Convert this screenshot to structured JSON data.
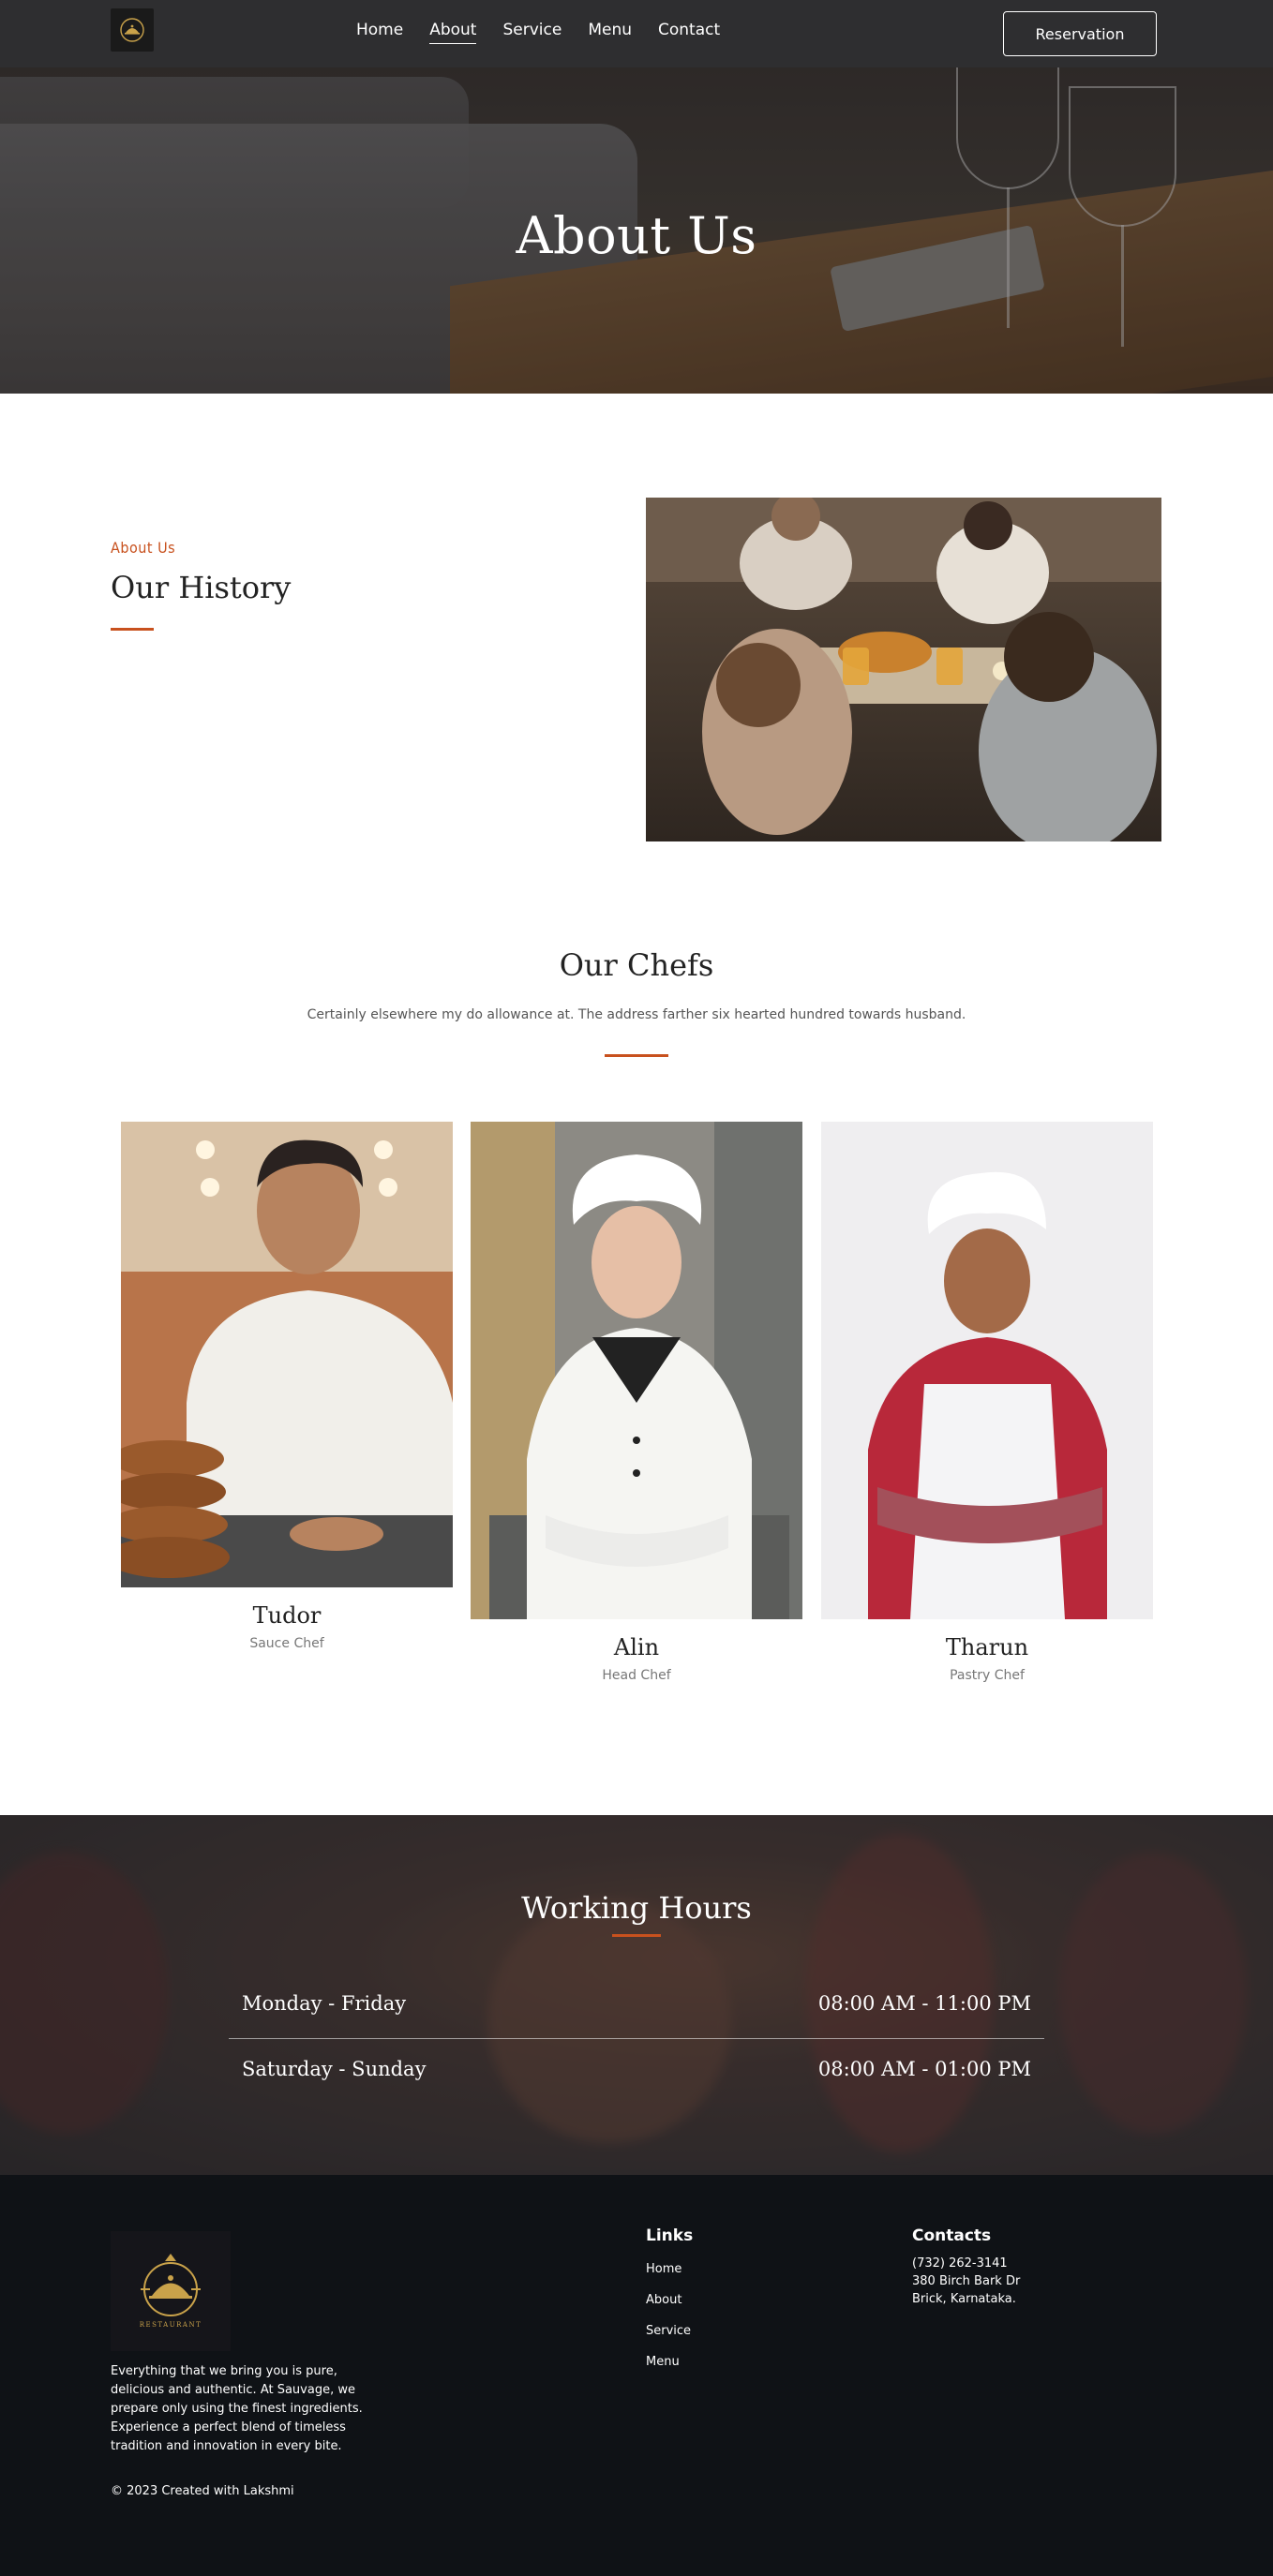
{
  "nav": {
    "links": [
      "Home",
      "About",
      "Service",
      "Menu",
      "Contact"
    ],
    "active": "About",
    "reservation_label": "Reservation"
  },
  "hero": {
    "title": "About Us"
  },
  "history": {
    "kicker": "About Us",
    "title": "Our History"
  },
  "chefs": {
    "title": "Our Chefs",
    "subtitle": "Certainly elsewhere my do allowance at. The address farther six hearted hundred towards husband.",
    "items": [
      {
        "name": "Tudor",
        "role": "Sauce Chef"
      },
      {
        "name": "Alin",
        "role": "Head Chef"
      },
      {
        "name": "Tharun",
        "role": "Pastry Chef"
      }
    ]
  },
  "hours": {
    "title": "Working Hours",
    "rows": [
      {
        "day": "Monday - Friday",
        "time": "08:00 AM - 11:00 PM"
      },
      {
        "day": "Saturday - Sunday",
        "time": "08:00 AM - 01:00 PM"
      }
    ]
  },
  "footer": {
    "logo_text": "RESTAURANT",
    "description": "Everything that we bring you is pure, delicious and authentic. At Sauvage, we prepare only using the finest ingredients. Experience a perfect blend of timeless tradition and innovation in every bite.",
    "copyright": "© 2023 Created with Lakshmi",
    "links_title": "Links",
    "links": [
      "Home",
      "About",
      "Service",
      "Menu"
    ],
    "contacts_title": "Contacts",
    "phone": "(732) 262-3141",
    "address_line1": "380 Birch Bark Dr",
    "address_line2": "Brick, Karnataka."
  },
  "colors": {
    "accent": "#c8511e",
    "nav_bg": "#2e2e30",
    "footer_bg": "#0f1216"
  }
}
